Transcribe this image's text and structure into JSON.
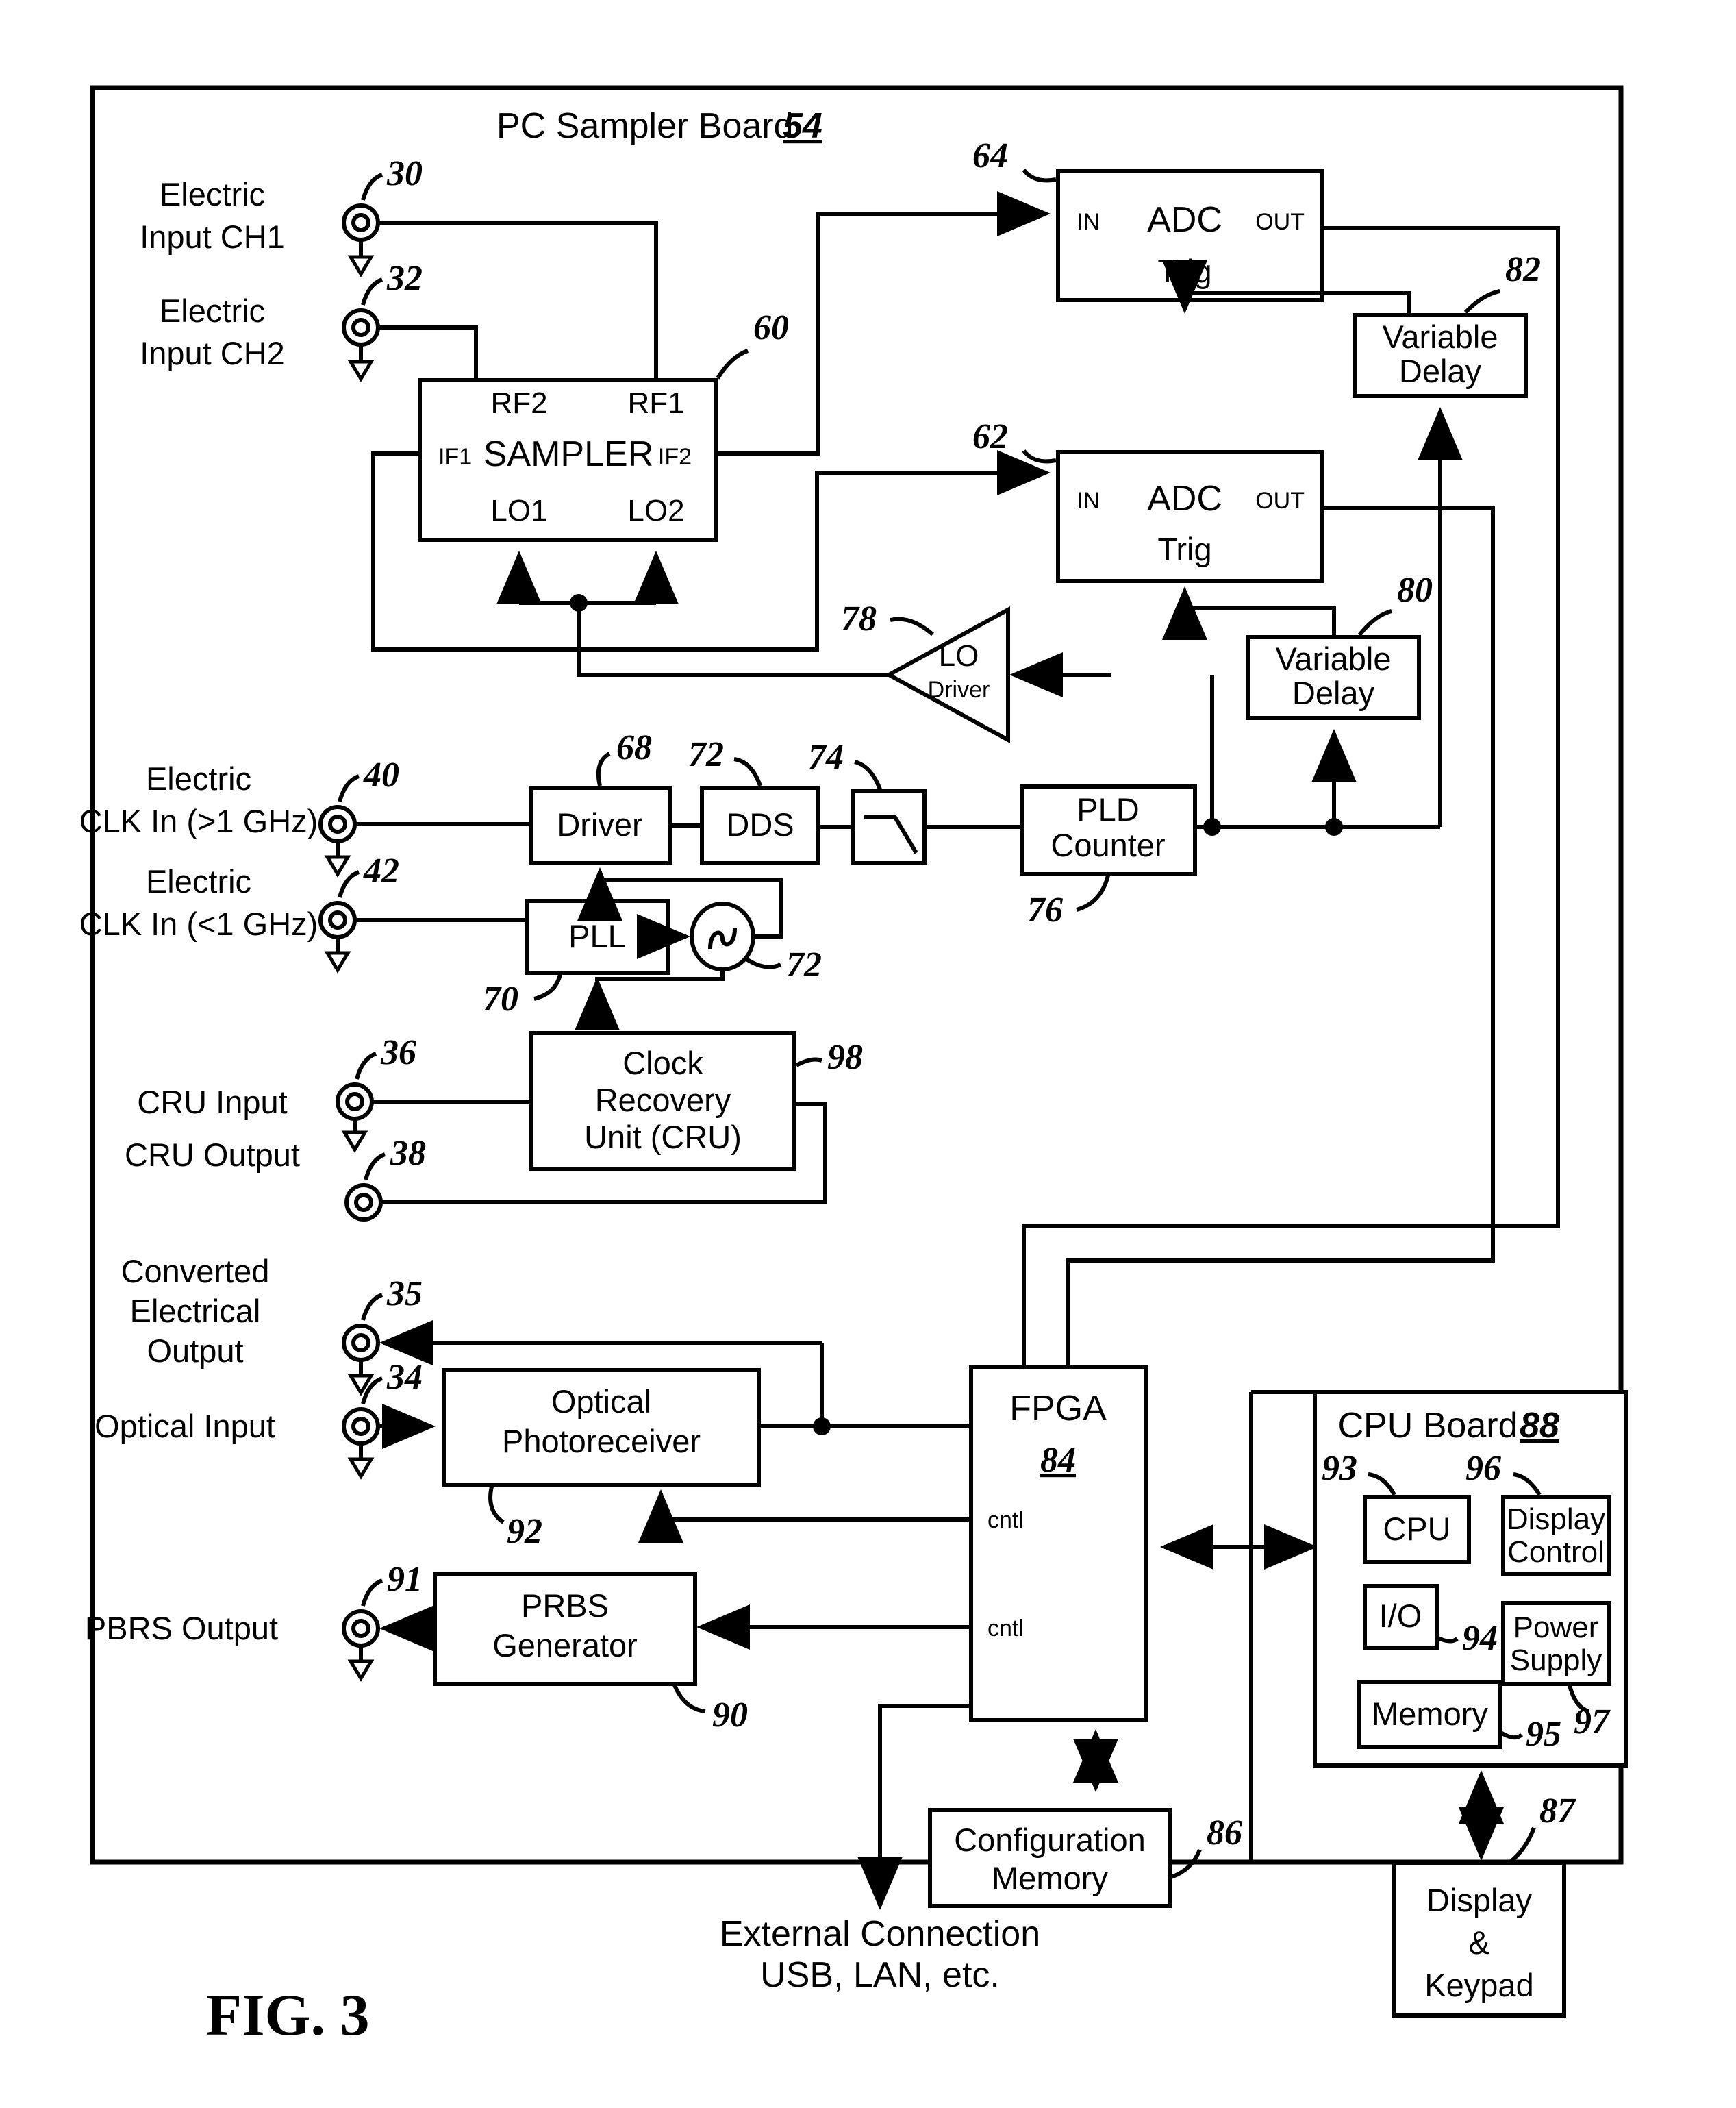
{
  "figure": {
    "caption": "FIG. 3",
    "board_title": "PC Sampler Board",
    "board_ref": "54"
  },
  "ports": [
    {
      "id": "p30",
      "label_line1": "Electric",
      "label_line2": "Input CH1",
      "ref": "30",
      "arrow": true
    },
    {
      "id": "p32",
      "label_line1": "Electric",
      "label_line2": "Input CH2",
      "ref": "32",
      "arrow": true
    },
    {
      "id": "p40",
      "label_line1": "Electric",
      "label_line2": "CLK In (>1 GHz)",
      "ref": "40",
      "arrow": true
    },
    {
      "id": "p42",
      "label_line1": "Electric",
      "label_line2": "CLK In (<1 GHz)",
      "ref": "42",
      "arrow": true
    },
    {
      "id": "p36",
      "label_line1": "",
      "label_line2": "CRU Input",
      "ref": "36",
      "arrow": true
    },
    {
      "id": "p38",
      "label_line1": "",
      "label_line2": "CRU Output",
      "ref": "38",
      "arrow": false
    },
    {
      "id": "p35",
      "label_line1": "Converted",
      "label_line2": "Electrical",
      "label_line3": "Output",
      "ref": "35",
      "arrow": true
    },
    {
      "id": "p34",
      "label_line1": "",
      "label_line2": "Optical Input",
      "ref": "34",
      "arrow": true
    },
    {
      "id": "p91",
      "label_line1": "",
      "label_line2": "PBRS Output",
      "ref": "91",
      "arrow": true
    }
  ],
  "blocks": {
    "sampler": {
      "name": "SAMPLER",
      "ref": "60",
      "pins": {
        "rf2": "RF2",
        "rf1": "RF1",
        "if1": "IF1",
        "if2": "IF2",
        "lo1": "LO1",
        "lo2": "LO2"
      }
    },
    "adc64": {
      "ref": "64",
      "pin_in": "IN",
      "name": "ADC",
      "pin_out": "OUT",
      "pin_trig": "Trig"
    },
    "adc62": {
      "ref": "62",
      "pin_in": "IN",
      "name": "ADC",
      "pin_out": "OUT",
      "pin_trig": "Trig"
    },
    "vardelay82": {
      "line1": "Variable",
      "line2": "Delay",
      "ref": "82"
    },
    "vardelay80": {
      "line1": "Variable",
      "line2": "Delay",
      "ref": "80"
    },
    "lodriver": {
      "line1": "LO",
      "line2": "Driver",
      "ref": "78"
    },
    "driver": {
      "name": "Driver",
      "ref": "68"
    },
    "dds": {
      "name": "DDS",
      "ref": "72"
    },
    "lpf": {
      "name": "",
      "ref": "74"
    },
    "pld": {
      "line1": "PLD",
      "line2": "Counter",
      "ref": "76"
    },
    "pll": {
      "name": "PLL",
      "ref": "70"
    },
    "osc": {
      "name": "",
      "ref": "72"
    },
    "cru": {
      "line1": "Clock",
      "line2": "Recovery",
      "line3": "Unit (CRU)",
      "ref": "98"
    },
    "photoreceiver": {
      "line1": "Optical",
      "line2": "Photoreceiver",
      "ref": "92"
    },
    "prbs": {
      "line1": "PRBS",
      "line2": "Generator",
      "ref": "90"
    },
    "fpga": {
      "name": "FPGA",
      "ref": "84",
      "cntl1": "cntl",
      "cntl2": "cntl"
    },
    "configmem": {
      "line1": "Configuration",
      "line2": "Memory",
      "ref": "86"
    },
    "cpuboard": {
      "title": "CPU Board",
      "ref": "88"
    },
    "cpu": {
      "name": "CPU",
      "ref": "93"
    },
    "io": {
      "name": "I/O",
      "ref": "94"
    },
    "memory": {
      "name": "Memory",
      "ref": "95"
    },
    "displaycontrol": {
      "line1": "Display",
      "line2": "Control",
      "ref": "96"
    },
    "powersupply": {
      "line1": "Power",
      "line2": "Supply",
      "ref": "97"
    },
    "displaykeypad": {
      "line1": "Display",
      "line2": "&",
      "line3": "Keypad",
      "ref": "87"
    }
  },
  "annotations": {
    "external_line1": "External Connection",
    "external_line2": "USB, LAN, etc."
  }
}
